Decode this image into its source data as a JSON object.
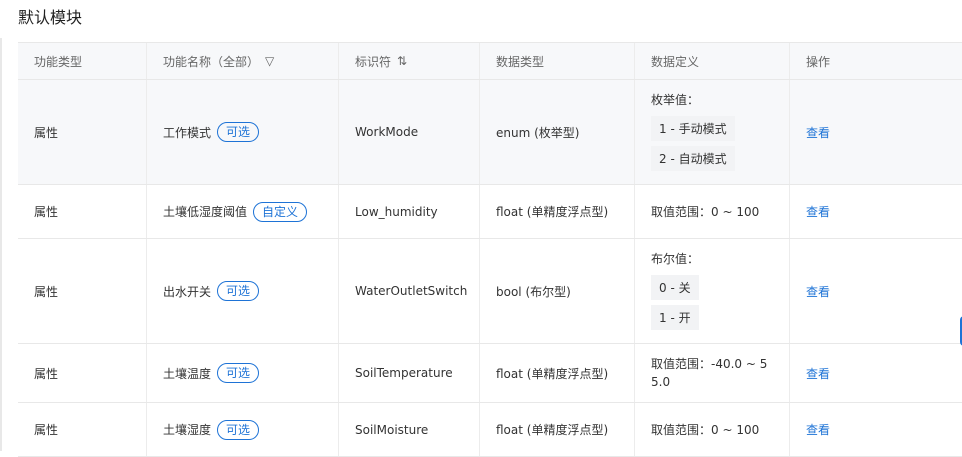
{
  "page": {
    "title": "默认模块"
  },
  "table": {
    "headers": {
      "type": "功能类型",
      "name": "功能名称（全部）",
      "identifier": "标识符",
      "data_type": "数据类型",
      "definition": "数据定义",
      "action": "操作"
    },
    "rows": [
      {
        "type": "属性",
        "name": "工作模式",
        "tag": "可选",
        "identifier": "WorkMode",
        "data_type": "enum (枚举型)",
        "def_label": "枚举值：",
        "def_items": [
          "1 - 手动模式",
          "2 - 自动模式"
        ],
        "action": "查看"
      },
      {
        "type": "属性",
        "name": "土壤低湿度阈值",
        "tag": "自定义",
        "identifier": "Low_humidity",
        "data_type": "float (单精度浮点型)",
        "def_text": "取值范围：0 ~ 100",
        "action": "查看"
      },
      {
        "type": "属性",
        "name": "出水开关",
        "tag": "可选",
        "identifier": "WaterOutletSwitch",
        "data_type": "bool (布尔型)",
        "def_label": "布尔值：",
        "def_items": [
          "0 - 关",
          "1 - 开"
        ],
        "action": "查看"
      },
      {
        "type": "属性",
        "name": "土壤温度",
        "tag": "可选",
        "identifier": "SoilTemperature",
        "data_type": "float (单精度浮点型)",
        "def_text": "取值范围：-40.0 ~ 55.0",
        "action": "查看"
      },
      {
        "type": "属性",
        "name": "土壤湿度",
        "tag": "可选",
        "identifier": "SoilMoisture",
        "data_type": "float (单精度浮点型)",
        "def_text": "取值范围：0 ~ 100",
        "action": "查看"
      }
    ]
  }
}
